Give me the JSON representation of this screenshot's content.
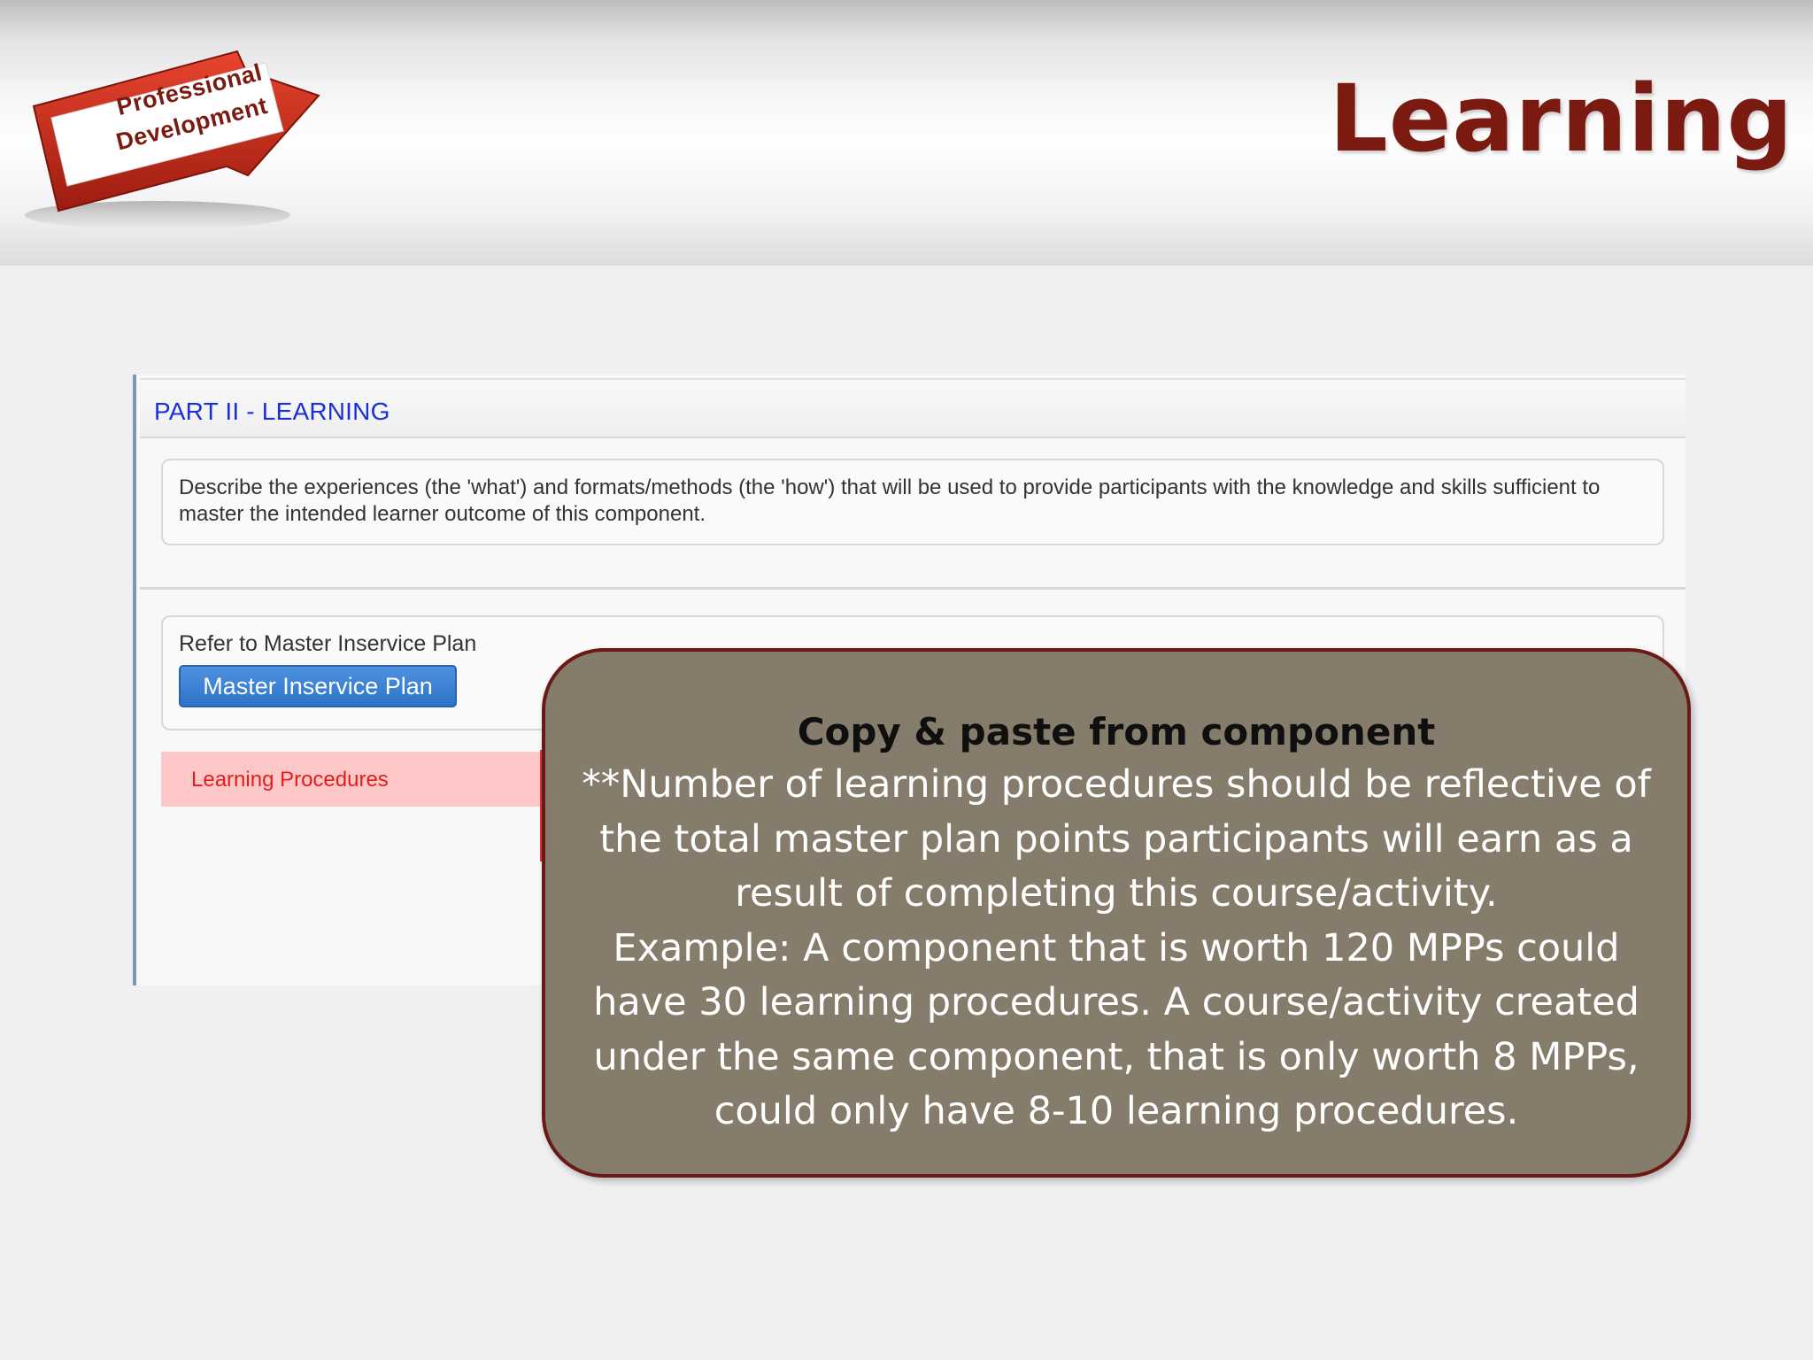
{
  "slide": {
    "title": "Learning",
    "logo": {
      "line1": "Professional",
      "line2": "Development"
    }
  },
  "app": {
    "section_title": "PART II - LEARNING",
    "description": "Describe the experiences (the 'what') and formats/methods (the 'how') that will be used to provide participants with the knowledge and skills sufficient to master the intended learner outcome of this component.",
    "refer_label": "Refer to Master Inservice Plan",
    "master_plan_button": "Master Inservice Plan",
    "learning_procedures_label": "Learning Procedures"
  },
  "callout": {
    "heading": "Copy & paste from component",
    "line1": "**Number of learning procedures should be reflective of",
    "line2": "the total master plan points participants will earn as a",
    "line3": "result of completing this course/activity.",
    "line4": "Example: A component that is worth 120 MPPs could",
    "line5": "have 30 learning procedures. A course/activity created",
    "line6": "under the same component, that is only worth 8 MPPs,",
    "line7": "could only have 8-10 learning procedures."
  },
  "colors": {
    "title": "#7a1a10",
    "section_title": "#1b2fd6",
    "button": "#2f73c9",
    "procedures_bg": "#ffc8c8",
    "procedures_text": "#e31d1d",
    "callout_bg": "#857c6b",
    "callout_border": "#6a1a14"
  }
}
